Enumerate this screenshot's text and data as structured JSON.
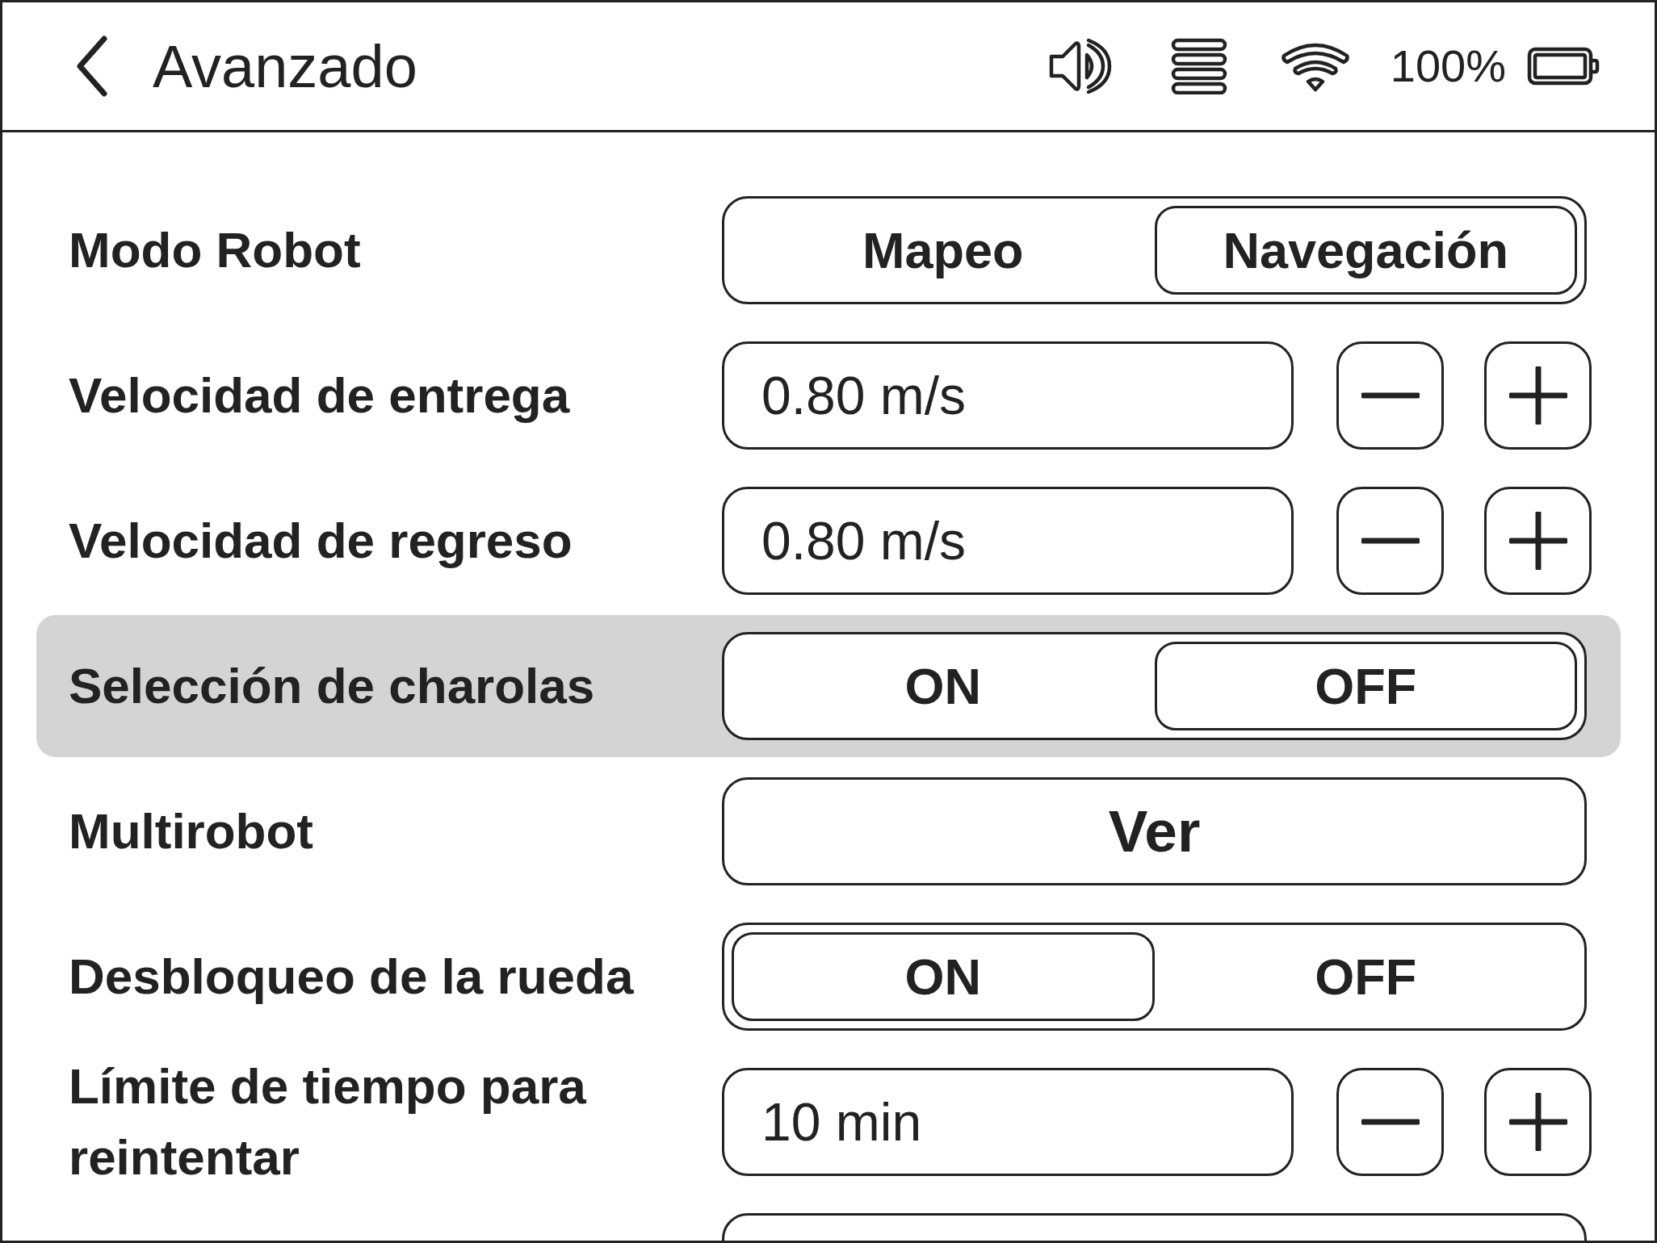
{
  "header": {
    "title": "Avanzado",
    "battery_text": "100%"
  },
  "settings": [
    {
      "kind": "segmented",
      "label": "Modo Robot",
      "highlighted": false,
      "options": [
        {
          "label": "Mapeo",
          "selected": false
        },
        {
          "label": "Navegación",
          "selected": true
        }
      ]
    },
    {
      "kind": "stepper",
      "label": "Velocidad de entrega",
      "highlighted": false,
      "value": "0.80 m/s"
    },
    {
      "kind": "stepper",
      "label": "Velocidad de regreso",
      "highlighted": false,
      "value": "0.80 m/s"
    },
    {
      "kind": "segmented",
      "label": "Selección de charolas",
      "highlighted": true,
      "options": [
        {
          "label": "ON",
          "selected": false
        },
        {
          "label": "OFF",
          "selected": true
        }
      ]
    },
    {
      "kind": "button",
      "label": "Multirobot",
      "highlighted": false,
      "value": "Ver"
    },
    {
      "kind": "segmented",
      "label": "Desbloqueo de la rueda",
      "highlighted": false,
      "options": [
        {
          "label": "ON",
          "selected": true
        },
        {
          "label": "OFF",
          "selected": false
        }
      ]
    },
    {
      "kind": "stepper",
      "label": "Límite de tiempo para reintentar",
      "highlighted": false,
      "value": "10 min"
    },
    {
      "kind": "partial",
      "highlighted": false
    }
  ]
}
